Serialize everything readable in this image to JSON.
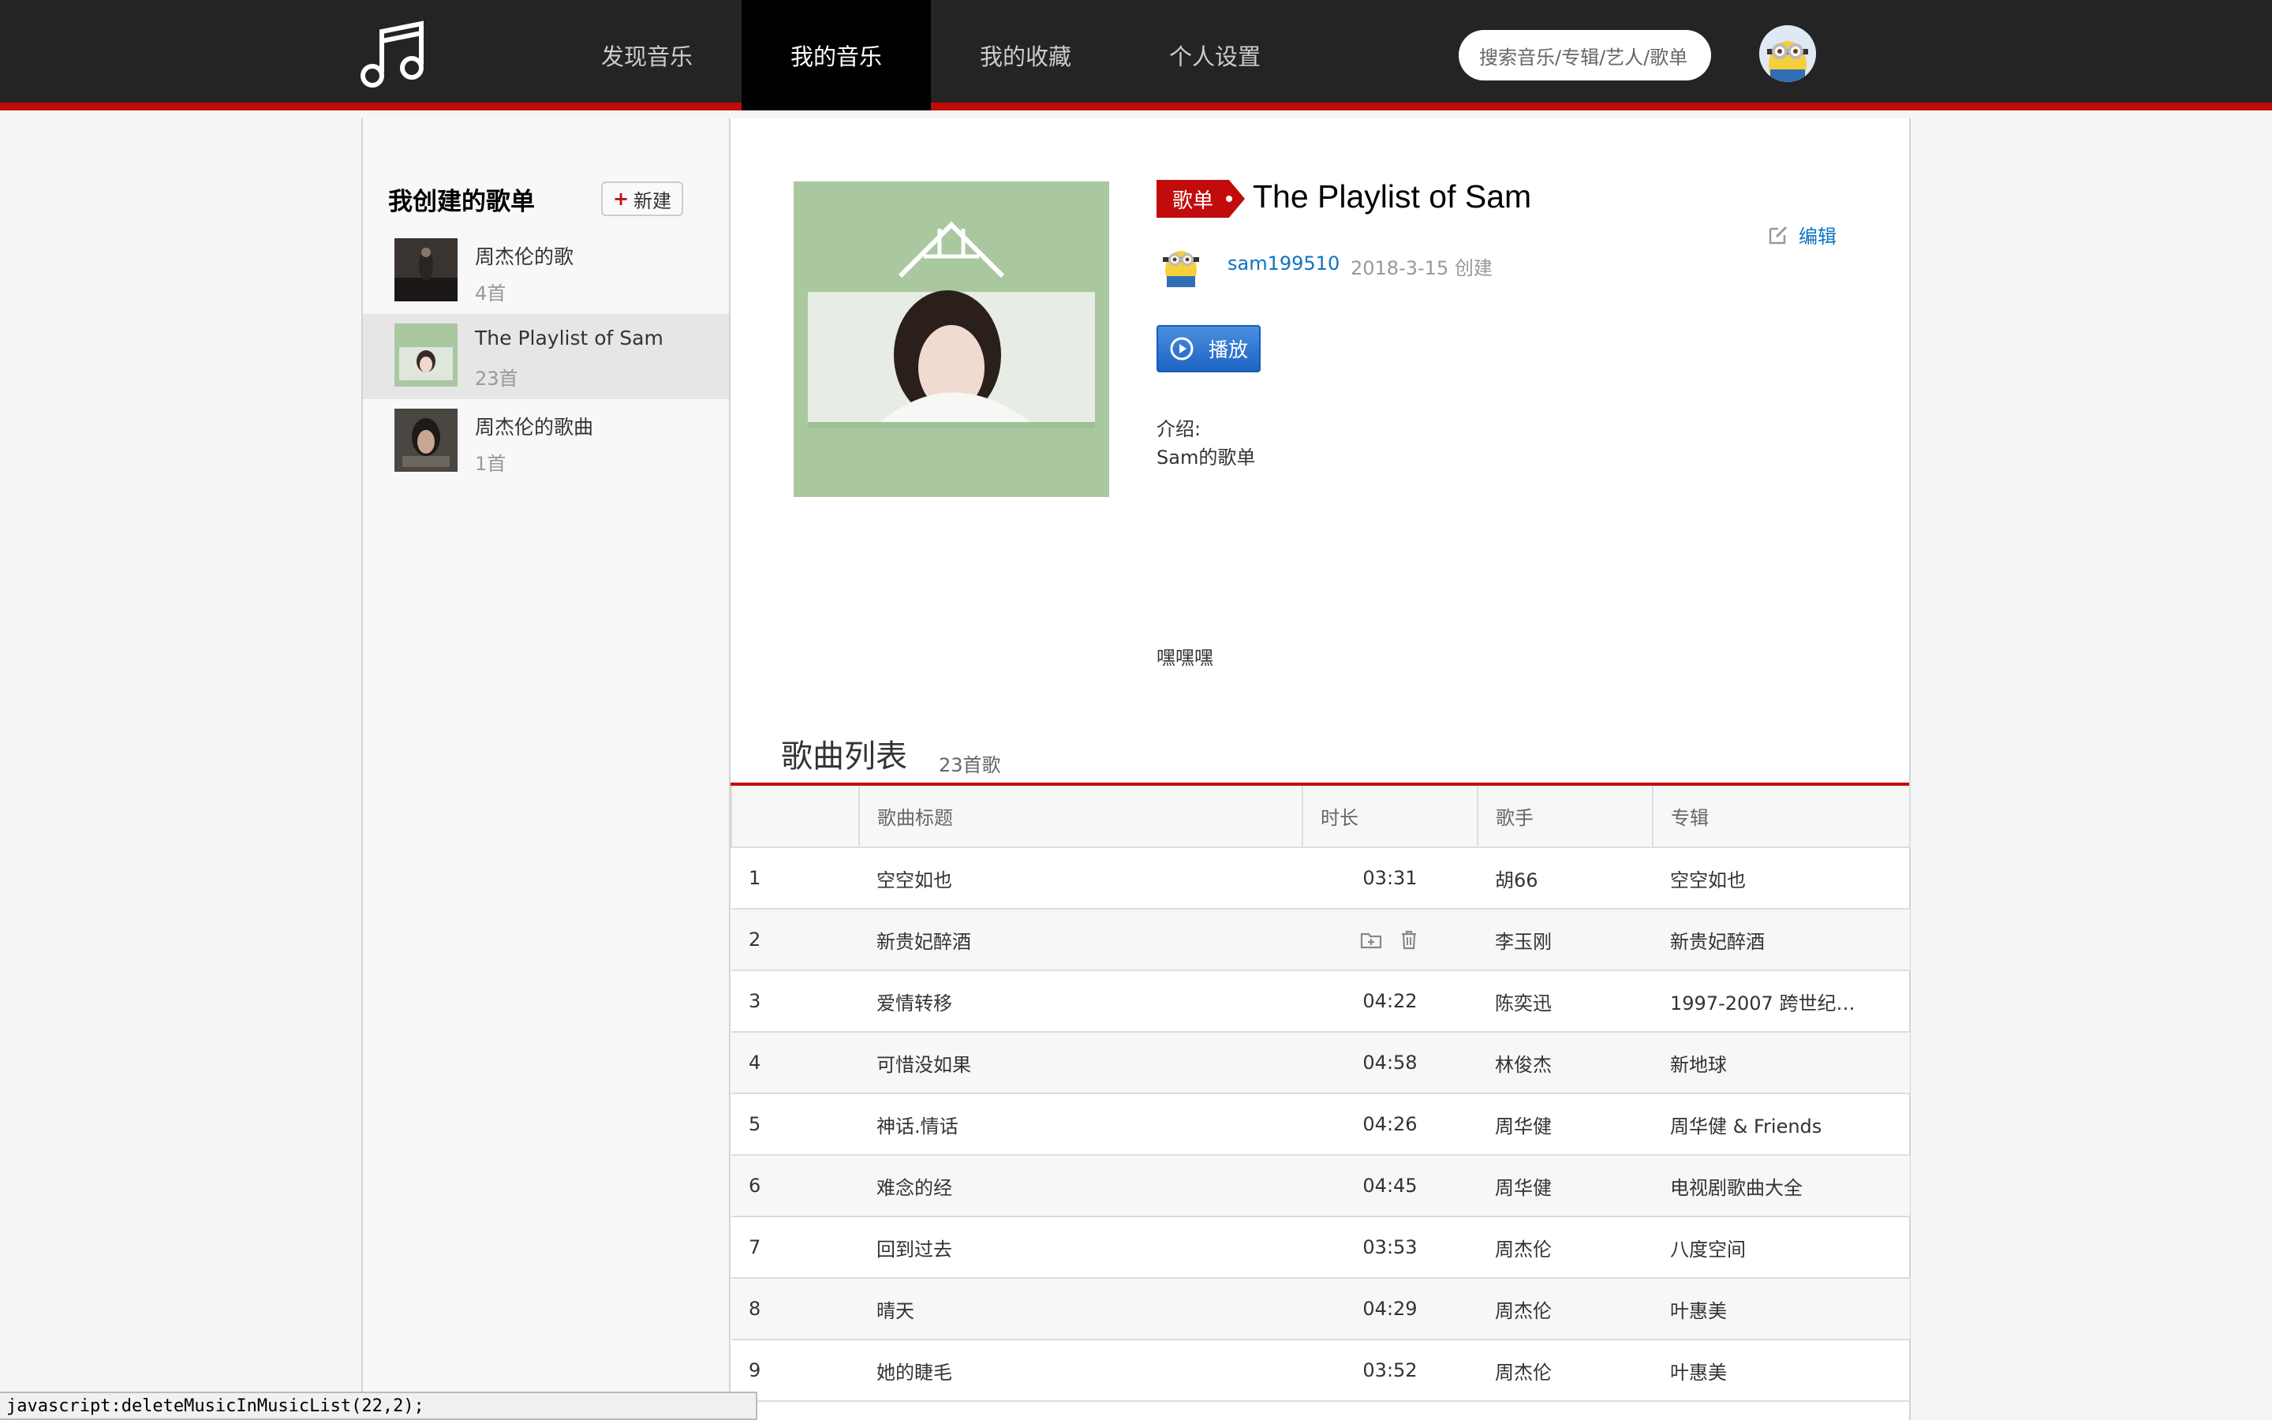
{
  "nav": {
    "items": [
      {
        "label": "发现音乐",
        "active": false
      },
      {
        "label": "我的音乐",
        "active": true
      },
      {
        "label": "我的收藏",
        "active": false
      },
      {
        "label": "个人设置",
        "active": false
      }
    ],
    "search_placeholder": "搜索音乐/专辑/艺人/歌单"
  },
  "sidebar": {
    "title": "我创建的歌单",
    "new_button": "新建",
    "new_button_icon": "+",
    "playlists": [
      {
        "name": "周杰伦的歌",
        "count": "4首",
        "active": false
      },
      {
        "name": "The Playlist of Sam",
        "count": "23首",
        "active": true
      },
      {
        "name": "周杰伦的歌曲",
        "count": "1首",
        "active": false
      }
    ]
  },
  "playlist": {
    "tag": "歌单",
    "title": "The Playlist of Sam",
    "edit_label": "编辑",
    "creator": "sam199510",
    "created": "2018-3-15 创建",
    "play_label": "播放",
    "intro_label": "介绍:",
    "intro_text": "Sam的歌单",
    "intro_extra": "嘿嘿嘿"
  },
  "songlist": {
    "title": "歌曲列表",
    "count": "23首歌",
    "columns": [
      "",
      "歌曲标题",
      "时长",
      "歌手",
      "专辑"
    ],
    "rows": [
      {
        "no": "1",
        "title": "空空如也",
        "duration": "03:31",
        "artist": "胡66",
        "album": "空空如也"
      },
      {
        "no": "2",
        "title": "新贵妃醉酒",
        "duration": "",
        "artist": "李玉刚",
        "album": "新贵妃醉酒",
        "hover": true
      },
      {
        "no": "3",
        "title": "爱情转移",
        "duration": "04:22",
        "artist": "陈奕迅",
        "album": "1997-2007 跨世纪…"
      },
      {
        "no": "4",
        "title": "可惜没如果",
        "duration": "04:58",
        "artist": "林俊杰",
        "album": "新地球"
      },
      {
        "no": "5",
        "title": "神话.情话",
        "duration": "04:26",
        "artist": "周华健",
        "album": "周华健 & Friends"
      },
      {
        "no": "6",
        "title": "难念的经",
        "duration": "04:45",
        "artist": "周华健",
        "album": "电视剧歌曲大全"
      },
      {
        "no": "7",
        "title": "回到过去",
        "duration": "03:53",
        "artist": "周杰伦",
        "album": "八度空间"
      },
      {
        "no": "8",
        "title": "晴天",
        "duration": "04:29",
        "artist": "周杰伦",
        "album": "叶惠美"
      },
      {
        "no": "9",
        "title": "她的睫毛",
        "duration": "03:52",
        "artist": "周杰伦",
        "album": "叶惠美"
      }
    ]
  },
  "status_bar": "javascript:deleteMusicInMusicList(22,2);",
  "colors": {
    "accent": "#c20c0c",
    "link": "#0c73c2",
    "topbar": "#242424"
  }
}
